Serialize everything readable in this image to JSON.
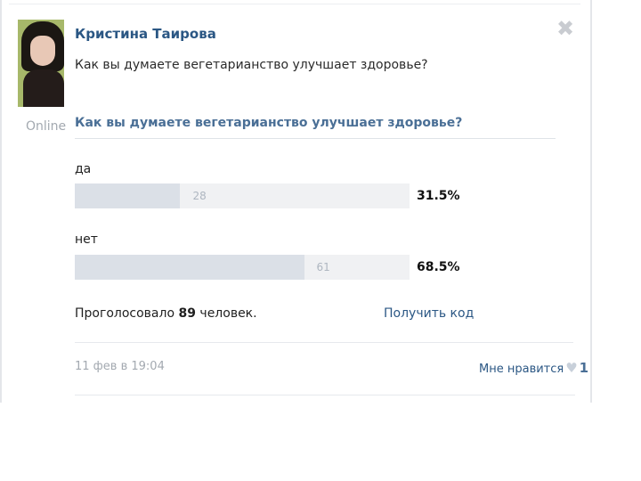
{
  "post": {
    "author": "Кристина Таирова",
    "status": "Online",
    "text": "Как вы думаете вегетарианство улучшает здоровье?",
    "close_icon": "close-icon"
  },
  "poll": {
    "title": "Как вы думаете вегетарианство улучшает здоровье?",
    "options": [
      {
        "label": "да",
        "count": "28",
        "percent": "31.5%",
        "fraction": 0.315
      },
      {
        "label": "нет",
        "count": "61",
        "percent": "68.5%",
        "fraction": 0.685
      }
    ],
    "voted_prefix": "Проголосовало",
    "voted_count": "89",
    "voted_suffix": "человек.",
    "get_code": "Получить код"
  },
  "footer": {
    "date": "11 фев в 19:04",
    "like_label": "Мне нравится",
    "like_icon": "heart-icon",
    "like_count": "1"
  },
  "colors": {
    "link": "#2b5784",
    "bar_fill": "#dbe0e7",
    "bar_track": "#f0f1f3"
  }
}
